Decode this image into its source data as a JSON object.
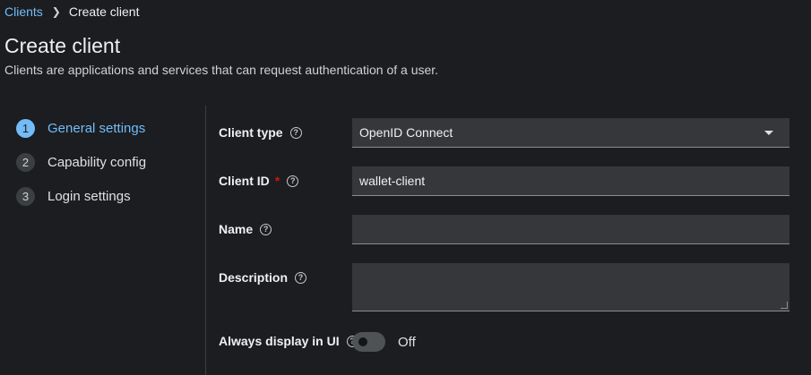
{
  "breadcrumb": {
    "parent": "Clients",
    "current": "Create client"
  },
  "header": {
    "title": "Create client",
    "description": "Clients are applications and services that can request authentication of a user."
  },
  "wizard": {
    "steps": [
      {
        "number": "1",
        "label": "General settings",
        "active": true
      },
      {
        "number": "2",
        "label": "Capability config",
        "active": false
      },
      {
        "number": "3",
        "label": "Login settings",
        "active": false
      }
    ]
  },
  "form": {
    "client_type": {
      "label": "Client type",
      "value": "OpenID Connect"
    },
    "client_id": {
      "label": "Client ID",
      "required_mark": "*",
      "value": "wallet-client"
    },
    "name": {
      "label": "Name",
      "value": ""
    },
    "description": {
      "label": "Description",
      "value": ""
    },
    "always_display": {
      "label": "Always display in UI",
      "state": "Off"
    }
  },
  "icons": {
    "help": "help-circle-icon",
    "breadcrumb_sep": "chevron-right-icon",
    "dropdown": "caret-down-icon"
  },
  "colors": {
    "accent": "#73bcf7",
    "background": "#1b1d21",
    "required": "#c9190b"
  }
}
